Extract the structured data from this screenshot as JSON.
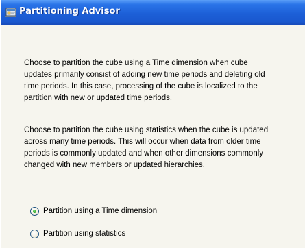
{
  "window": {
    "title": "Partitioning Advisor",
    "icon": "cube-window-icon"
  },
  "content": {
    "paragraph1": [
      "Choose to partition the cube using a Time dimension when cube",
      "updates primarily consist of adding new time periods and deleting old",
      "time periods. In this case, processing of the cube is localized to the",
      "partition with new or updated time periods."
    ],
    "paragraph2": [
      "Choose to partition the cube using statistics when the cube is updated",
      "across many time periods. This will occur when data from older time",
      "periods is commonly updated and when other dimensions commonly",
      "changed with new members or updated hierarchies."
    ]
  },
  "options": [
    {
      "label": "Partition using a Time dimension",
      "selected": true
    },
    {
      "label": "Partition using statistics",
      "selected": false
    }
  ],
  "colors": {
    "title_bar": "#1c5fd7",
    "background": "#f6f5ee",
    "focus_border": "#e5a73f",
    "radio_dot": "#2fa82a"
  }
}
